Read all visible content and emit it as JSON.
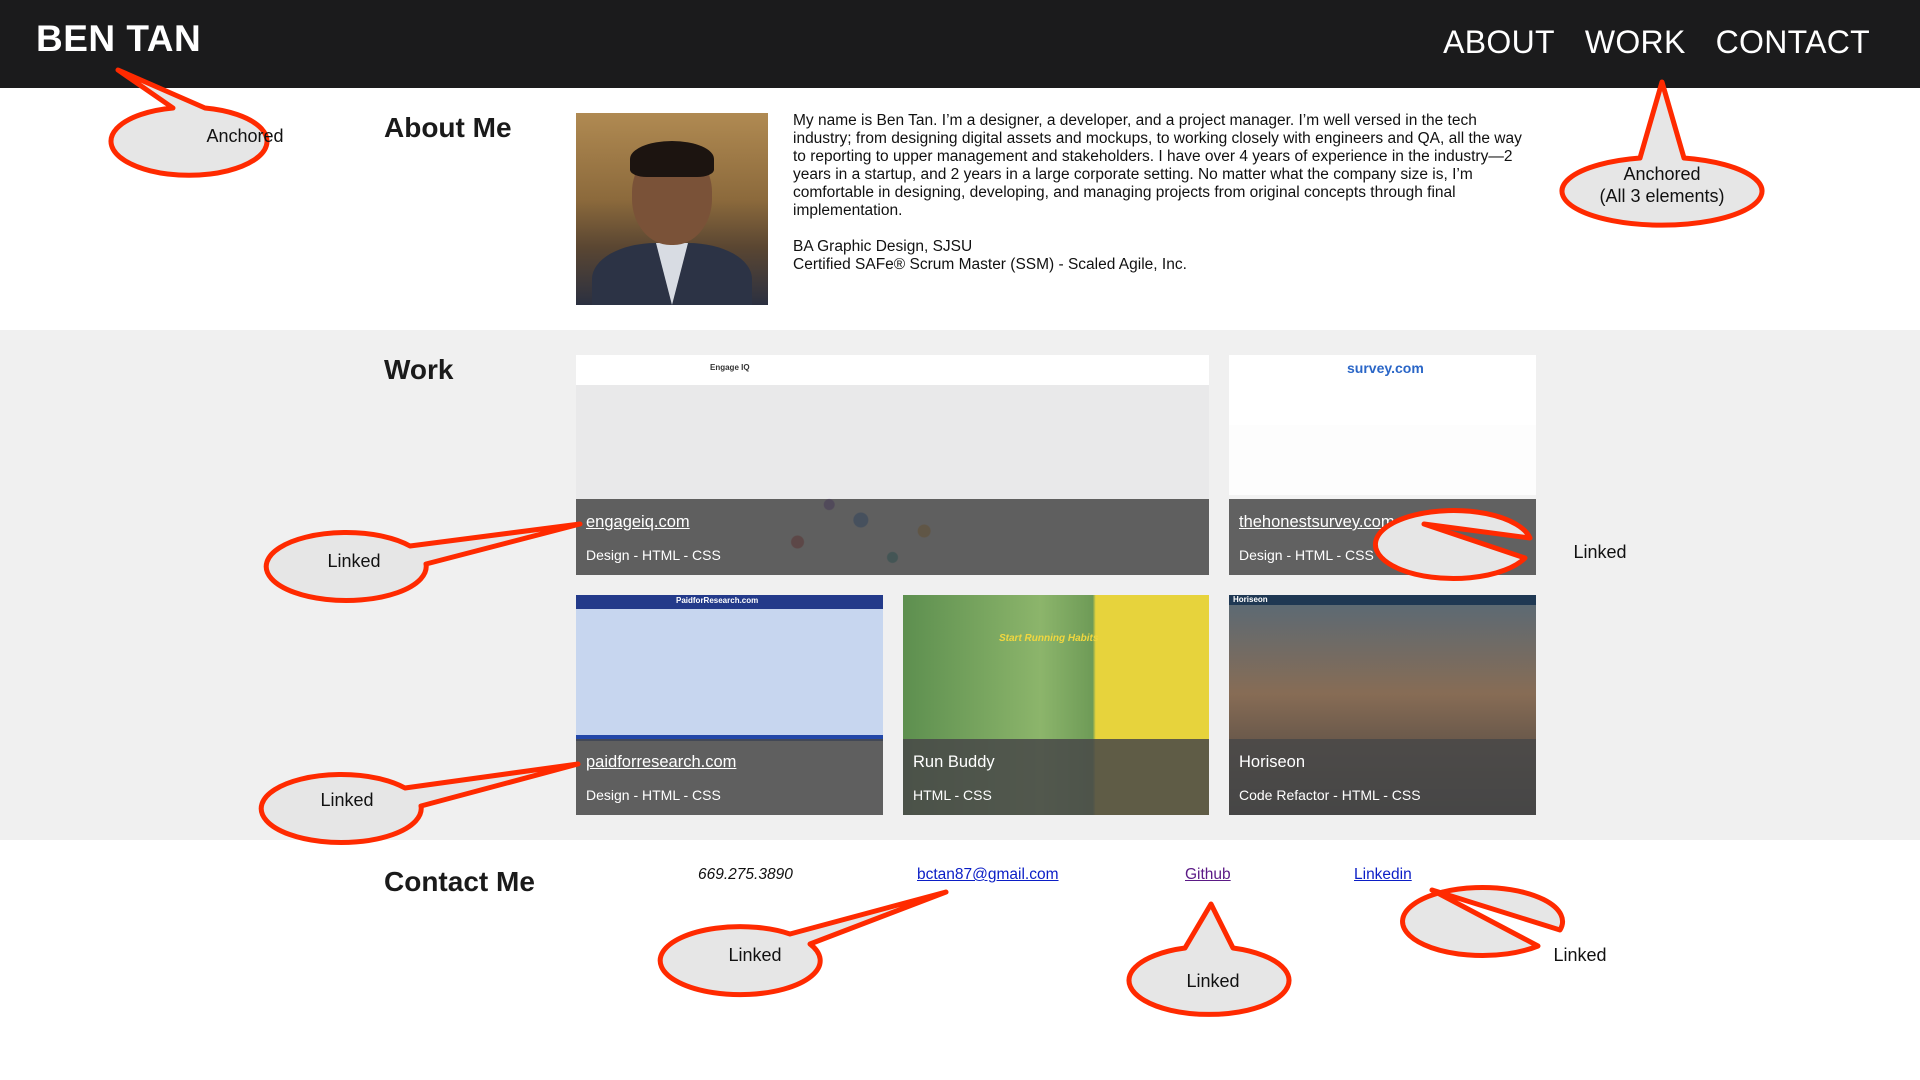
{
  "header": {
    "brand": "BEN TAN",
    "nav": [
      "ABOUT",
      "WORK",
      "CONTACT"
    ]
  },
  "about": {
    "title": "About Me",
    "bio": "My name is Ben Tan. I’m a designer, a developer, and a project manager. I’m well versed in the tech industry; from designing digital assets and mockups, to working closely with engineers and QA, all the way to reporting to upper management and stakeholders. I have over 4 years of experience in the industry—2 years in a startup, and 2 years in a large corporate setting. No matter what the company size is, I’m comfortable in designing, developing, and managing projects from original concepts through final implementation.",
    "education": "BA Graphic Design, SJSU",
    "certification": "Certified SAFe® Scrum Master (SSM) - Scaled Agile, Inc."
  },
  "work": {
    "title": "Work",
    "cards": [
      {
        "title": "engageiq.com",
        "tags": "Design - HTML - CSS",
        "thumb_text": "Engage IQ"
      },
      {
        "title": "thehonestsurvey.com",
        "tags": "Design - HTML - CSS",
        "thumb_text": "survey.com"
      },
      {
        "title": "paidforresearch.com",
        "tags": "Design - HTML - CSS",
        "thumb_text": "PaidforResearch.com"
      },
      {
        "title": "Run Buddy",
        "tags": "HTML - CSS",
        "thumb_text": "Start Running Habits"
      },
      {
        "title": "Horiseon",
        "tags": "Code Refactor - HTML - CSS",
        "thumb_text": "Horiseon"
      }
    ]
  },
  "contact": {
    "title": "Contact Me",
    "phone": "669.275.3890",
    "email": "bctan87@gmail.com",
    "github": "Github",
    "linkedin": "Linkedin"
  },
  "callouts": {
    "anchored": "Anchored",
    "anchored_all_1": "Anchored",
    "anchored_all_2": "(All 3 elements)",
    "linked": "Linked"
  },
  "colors": {
    "header_bg": "#1b1b1c",
    "work_bg": "#f0f0f0",
    "callout_stroke": "#ff2a00",
    "callout_fill": "#e6e6e6",
    "link": "#0b1ec6"
  }
}
